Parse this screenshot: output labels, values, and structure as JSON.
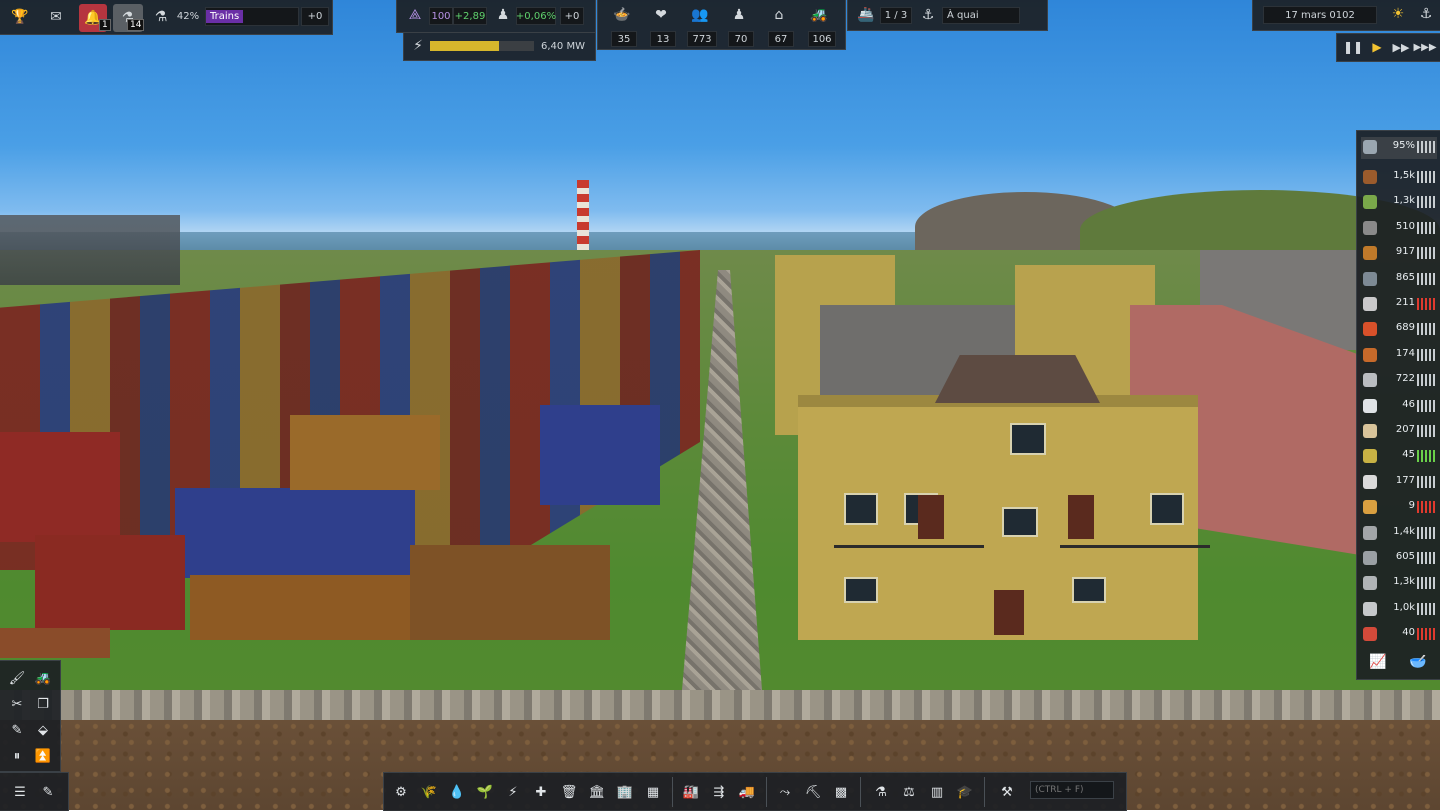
{
  "top_left": {
    "notif_alerts": "1",
    "notif_research": "14",
    "research_pct": "42%",
    "research_name": "Trains",
    "research_delta": "+0"
  },
  "unity": {
    "value": "100",
    "delta": "+2,89",
    "pop_growth": "+0,06%",
    "pop_delta": "+0"
  },
  "power": {
    "value": "6,40 MW",
    "fill": 0.66
  },
  "needs": [
    "35",
    "13",
    "773",
    "70",
    "67",
    "106"
  ],
  "ships": {
    "count": "1 / 3",
    "status": "À quai"
  },
  "date": "17 mars 0102",
  "resources": [
    {
      "value": "95%",
      "bar": "white",
      "color": "#9aa6b0",
      "icon": "maintenance-icon"
    },
    {
      "value": "1,5k",
      "bar": "white",
      "color": "#9b5b2c",
      "icon": "food-icon"
    },
    {
      "value": "1,3k",
      "bar": "white",
      "color": "#7aa84a",
      "icon": "vegetables-icon"
    },
    {
      "value": "510",
      "bar": "white",
      "color": "#8a8a8a",
      "icon": "iron-icon"
    },
    {
      "value": "917",
      "bar": "white",
      "color": "#c07a2a",
      "icon": "wood-icon"
    },
    {
      "value": "865",
      "bar": "white",
      "color": "#7d8a94",
      "icon": "stone-icon"
    },
    {
      "value": "211",
      "bar": "red",
      "color": "#c9c9c9",
      "icon": "tools-icon"
    },
    {
      "value": "689",
      "bar": "white",
      "color": "#d8512a",
      "icon": "fuel-icon"
    },
    {
      "value": "174",
      "bar": "white",
      "color": "#c66a2a",
      "icon": "planks-icon"
    },
    {
      "value": "722",
      "bar": "white",
      "color": "#b9bdc0",
      "icon": "concrete-icon"
    },
    {
      "value": "46",
      "bar": "white",
      "color": "#dfe3e6",
      "icon": "medical-icon"
    },
    {
      "value": "207",
      "bar": "white",
      "color": "#d8c49a",
      "icon": "bread-icon"
    },
    {
      "value": "45",
      "bar": "green",
      "color": "#c8b244",
      "icon": "gold-icon"
    },
    {
      "value": "177",
      "bar": "white",
      "color": "#dadada",
      "icon": "pipes-icon"
    },
    {
      "value": "9",
      "bar": "red",
      "color": "#d9a040",
      "icon": "beer-icon"
    },
    {
      "value": "1,4k",
      "bar": "white",
      "color": "#a2a6a8",
      "icon": "coal-icon"
    },
    {
      "value": "605",
      "bar": "white",
      "color": "#9aa0a4",
      "icon": "steel-icon"
    },
    {
      "value": "1,3k",
      "bar": "white",
      "color": "#b0b4b6",
      "icon": "sand-icon"
    },
    {
      "value": "1,0k",
      "bar": "white",
      "color": "#c5c8ca",
      "icon": "glass-icon"
    },
    {
      "value": "40",
      "bar": "red",
      "color": "#d34a3a",
      "icon": "oil-icon"
    }
  ],
  "search_placeholder": "(CTRL + F)"
}
